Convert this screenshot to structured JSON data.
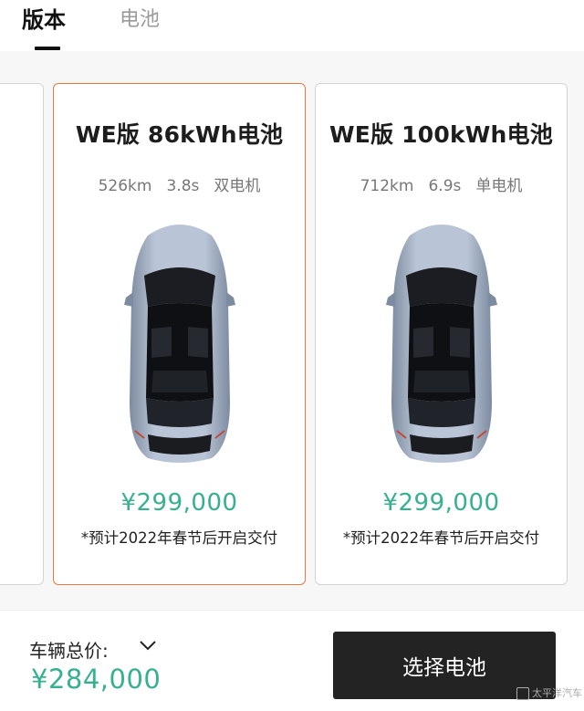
{
  "tabs": [
    {
      "label": "版本",
      "active": true
    },
    {
      "label": "电池",
      "active": false
    }
  ],
  "cards": [
    {
      "title": "WE版 86kWh电池",
      "range": "526km",
      "acceleration": "3.8s",
      "motor": "双电机",
      "price": "¥299,000",
      "note": "*预计2022年春节后开启交付",
      "selected": true
    },
    {
      "title": "WE版 100kWh电池",
      "range": "712km",
      "acceleration": "6.9s",
      "motor": "单电机",
      "price": "¥299,000",
      "note": "*预计2022年春节后开启交付",
      "selected": false
    }
  ],
  "footer": {
    "total_label": "车辆总价:",
    "total_price": "¥284,000",
    "select_button": "选择电池",
    "watermark": "太平洋汽车"
  },
  "colors": {
    "accent_price": "#36b090",
    "selected_border": "#e57a3e",
    "button_bg": "#232323",
    "car_body": "#a9b6c8"
  },
  "icons": [
    "chevron-down-icon",
    "car-top-view-image"
  ]
}
